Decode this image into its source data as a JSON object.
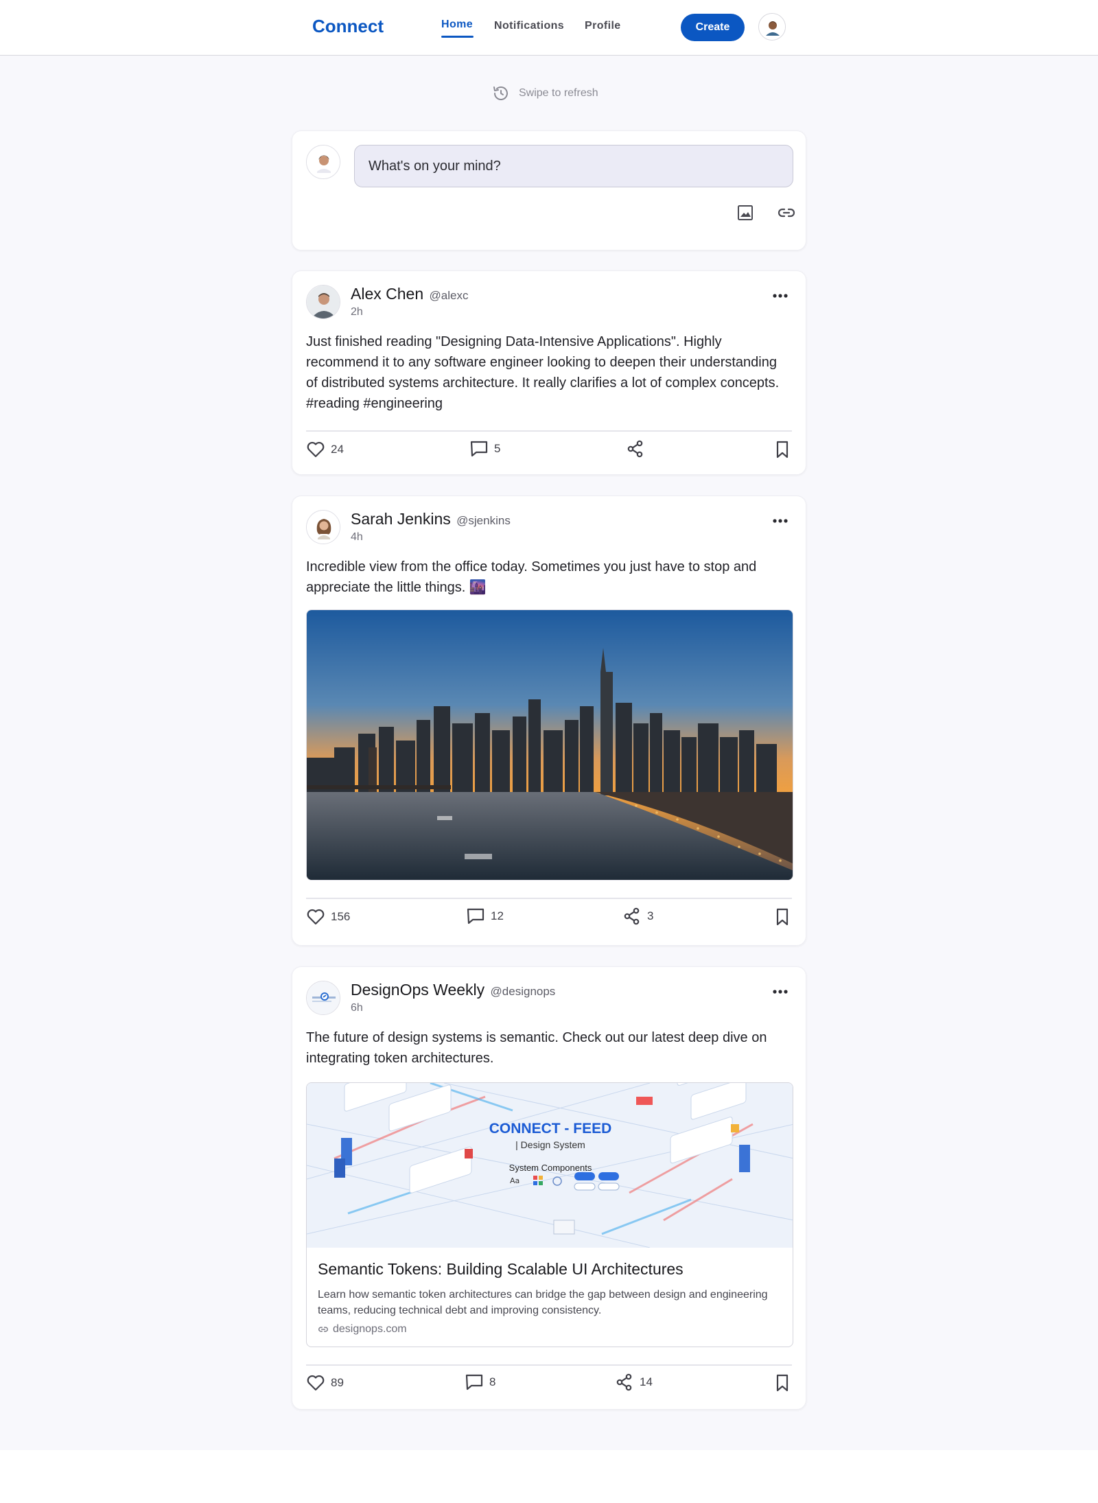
{
  "app": {
    "brand": "Connect"
  },
  "nav": {
    "tabs": [
      {
        "label": "Home",
        "active": true
      },
      {
        "label": "Notifications",
        "active": false
      },
      {
        "label": "Profile",
        "active": false
      }
    ],
    "create_label": "Create"
  },
  "refresh": {
    "label": "Swipe to refresh"
  },
  "composer": {
    "placeholder": "What's on your mind?"
  },
  "posts": [
    {
      "author": "Alex Chen",
      "handle": "@alexc",
      "time": "2h",
      "text": "Just finished reading \"Designing Data-Intensive Applications\". Highly recommend it to any software engineer looking to deepen their understanding of distributed systems architecture. It really clarifies a lot of complex concepts. #reading #engineering",
      "likes": "24",
      "comments": "5",
      "shares": ""
    },
    {
      "author": "Sarah Jenkins",
      "handle": "@sjenkins",
      "time": "4h",
      "text": "Incredible view from the office today. Sometimes you just have to stop and appreciate the little things. 🌆",
      "likes": "156",
      "comments": "12",
      "shares": "3"
    },
    {
      "author": "DesignOps Weekly",
      "handle": "@designops",
      "time": "6h",
      "text": "The future of design systems is semantic. Check out our latest deep dive on integrating token architectures.",
      "likes": "89",
      "comments": "8",
      "shares": "14",
      "link": {
        "image_heading": "CONNECT - FEED",
        "image_subheading": "| Design System",
        "image_section": "System Components",
        "title": "Semantic Tokens: Building Scalable UI Architectures",
        "description": "Learn how semantic token architectures can bridge the gap between design and engineering teams, reducing technical debt and improving consistency.",
        "domain": "designops.com"
      }
    }
  ],
  "colors": {
    "accent": "#0b57c2",
    "background": "#f8f8fc",
    "card": "#ffffff"
  }
}
